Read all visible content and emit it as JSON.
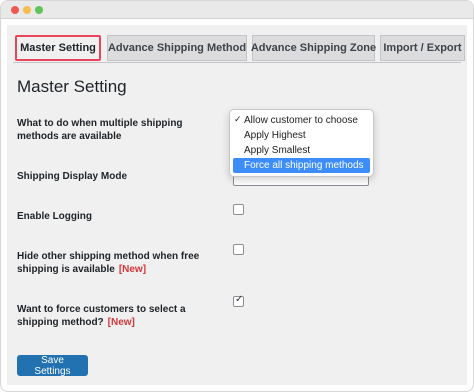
{
  "tabs": [
    {
      "label": "Master Setting",
      "active": true
    },
    {
      "label": "Advance Shipping Method",
      "active": false
    },
    {
      "label": "Advance Shipping Zone",
      "active": false
    },
    {
      "label": "Import / Export",
      "active": false
    }
  ],
  "page_title": "Master Setting",
  "settings": {
    "multiple_methods": {
      "label": "What to do when multiple shipping methods are available"
    },
    "display_mode": {
      "label": "Shipping Display Mode"
    },
    "enable_logging": {
      "label": "Enable Logging",
      "checked": false
    },
    "hide_other": {
      "label": "Hide other shipping method when free shipping is available",
      "badge": "[New]",
      "checked": false
    },
    "force_select": {
      "label": "Want to force customers to select a shipping method?",
      "badge": "[New]",
      "checked": true
    }
  },
  "dropdown": {
    "selected": "Allow customer to choose",
    "options": [
      "Allow customer to choose",
      "Apply Highest",
      "Apply Smallest",
      "Force all shipping methods"
    ],
    "highlighted": "Force all shipping methods"
  },
  "save_button": {
    "label": "Save Settings"
  },
  "colors": {
    "accent": "#2271b1",
    "tab_highlight": "#e8455c",
    "new_badge": "#d63638",
    "dropdown_highlight": "#3c8dfa"
  }
}
